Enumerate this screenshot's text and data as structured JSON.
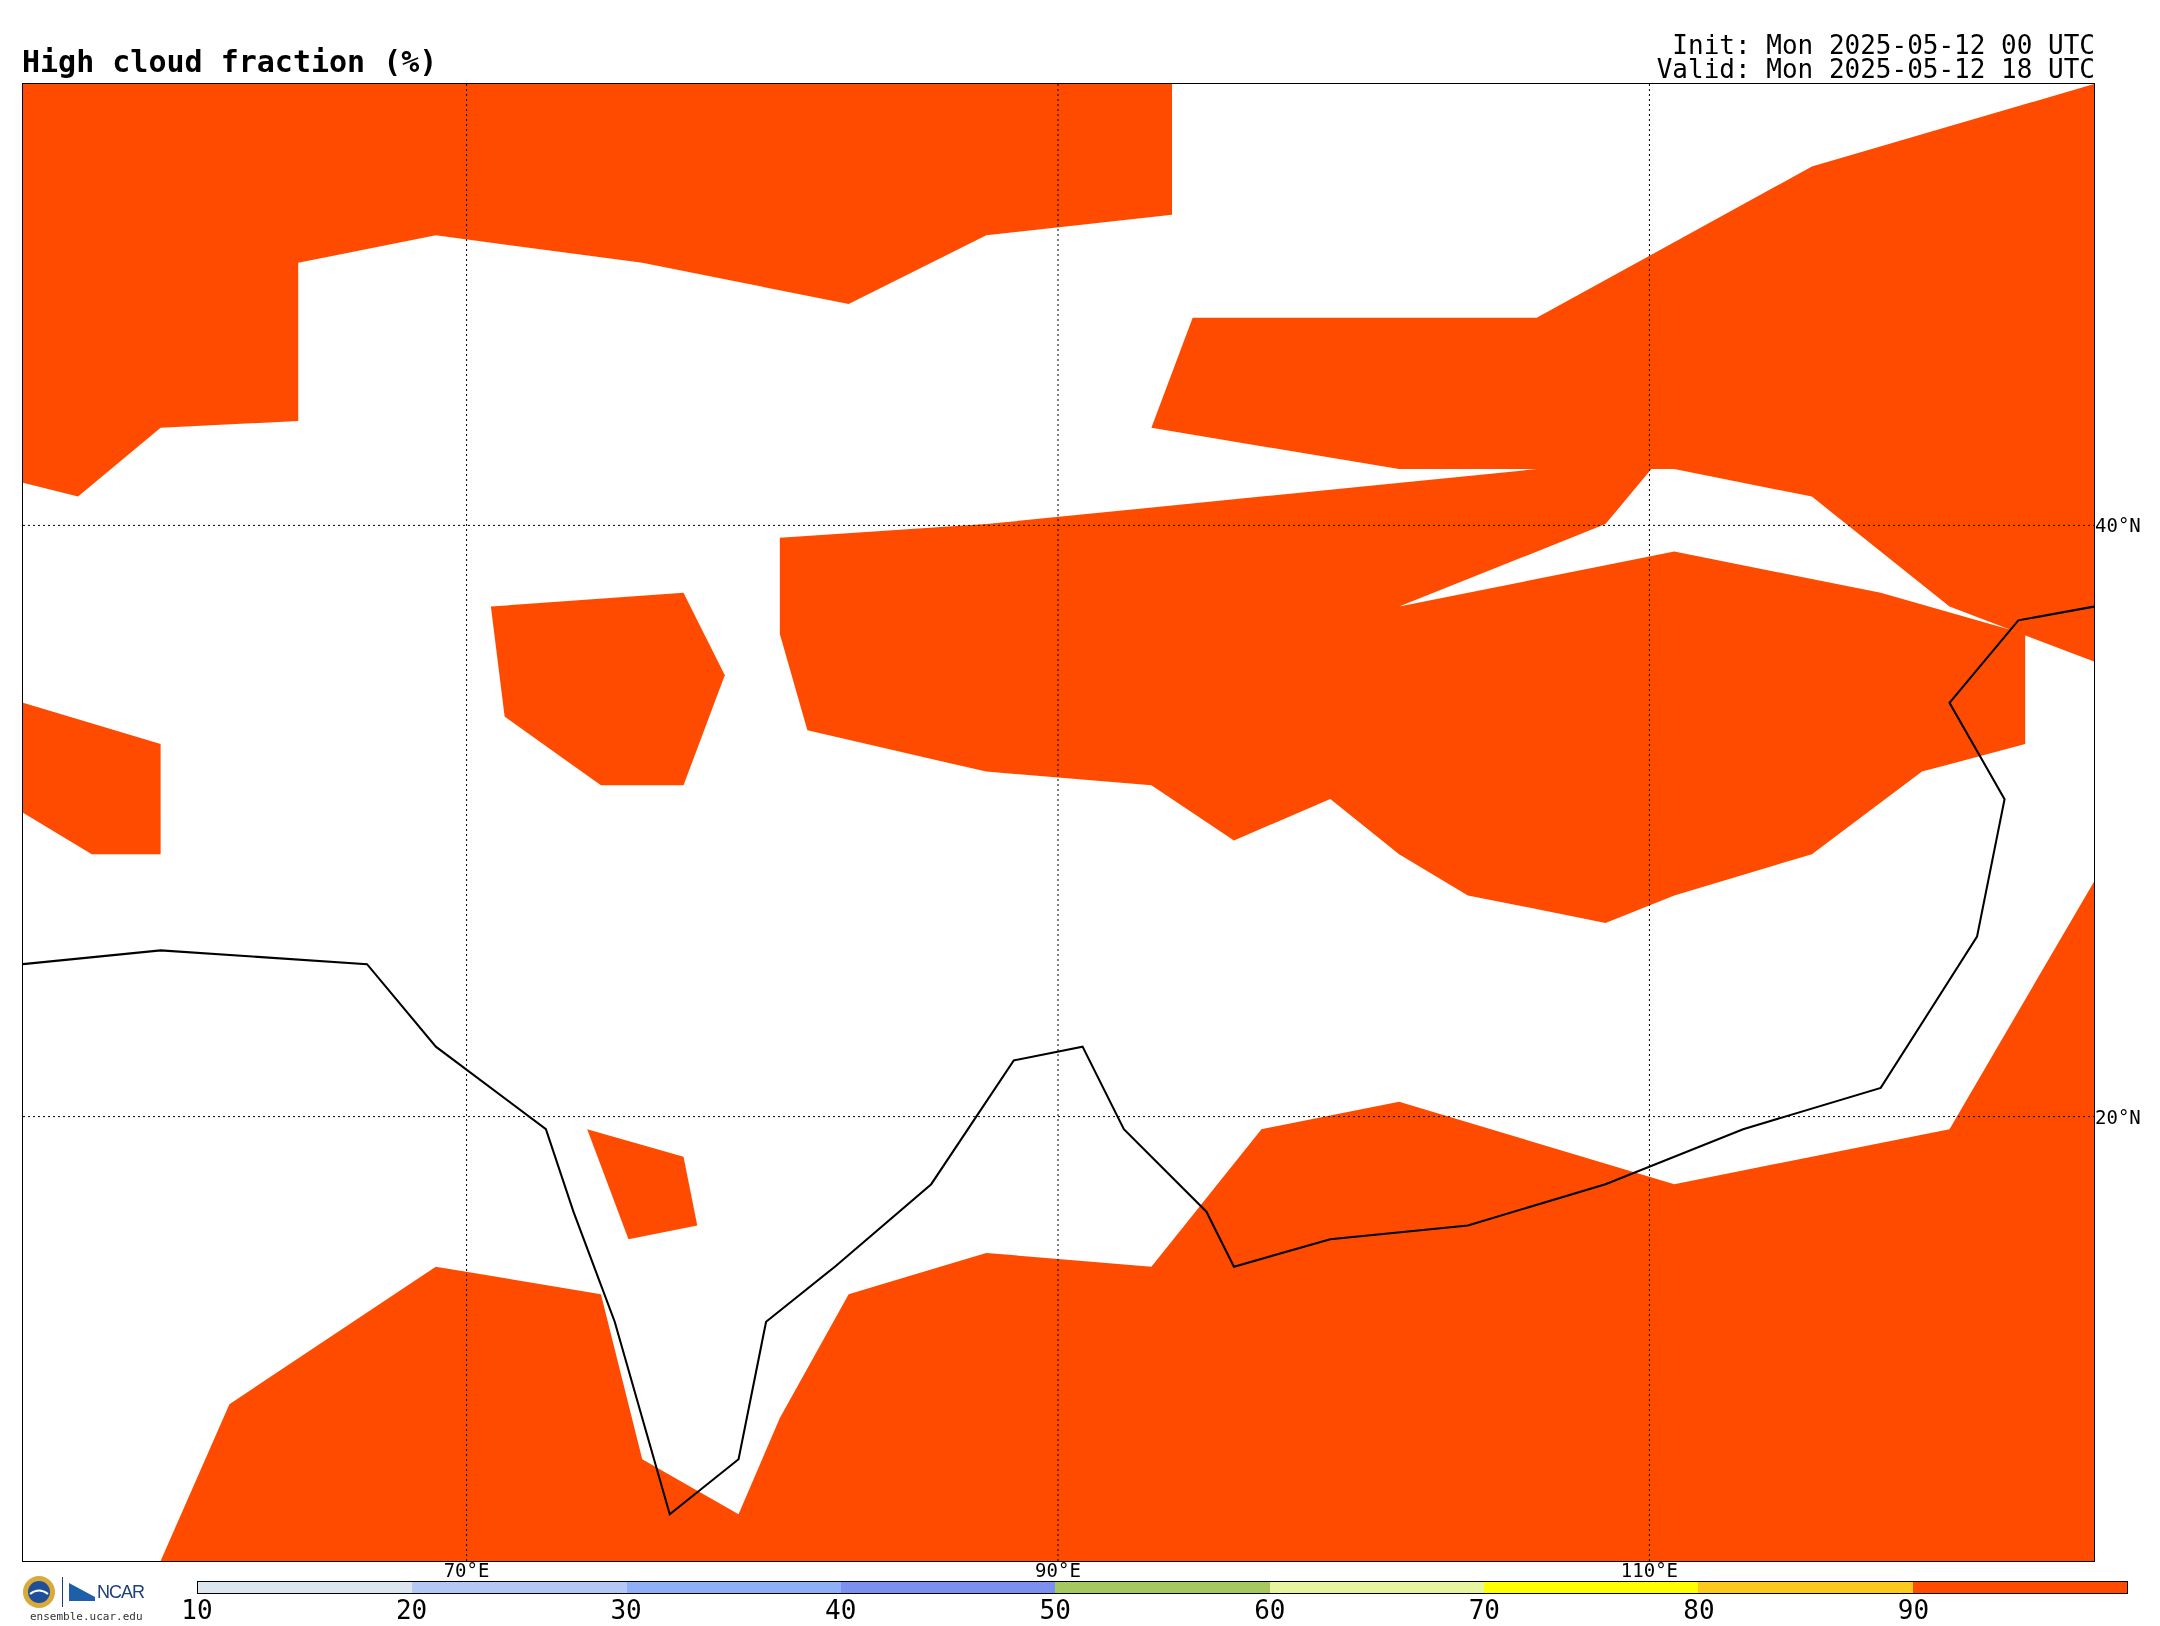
{
  "title": "High cloud fraction (%)",
  "run_info": [
    "Init: Mon 2025-05-12 00 UTC",
    "Valid: Mon 2025-05-12 18 UTC"
  ],
  "map": {
    "longitudes": [
      {
        "label": "70°E"
      },
      {
        "label": "90°E"
      },
      {
        "label": "110°E"
      }
    ],
    "latitudes": [
      {
        "label": "40°N"
      },
      {
        "label": "20°N"
      }
    ]
  },
  "logos": {
    "ncar": "NCAR",
    "url": "ensemble.ucar.edu"
  },
  "colorbar": {
    "bins": [
      {
        "tick": "10",
        "color": "#dce6ef"
      },
      {
        "tick": "20",
        "color": "#b4c8f5"
      },
      {
        "tick": "30",
        "color": "#8fb0f7"
      },
      {
        "tick": "40",
        "color": "#7c90f0"
      },
      {
        "tick": "50",
        "color": "#a5c85f"
      },
      {
        "tick": "60",
        "color": "#e8f5a0"
      },
      {
        "tick": "70",
        "color": "#ffff00"
      },
      {
        "tick": "80",
        "color": "#fdc91c"
      },
      {
        "tick": "90",
        "color": "#ff4b00"
      }
    ]
  }
}
